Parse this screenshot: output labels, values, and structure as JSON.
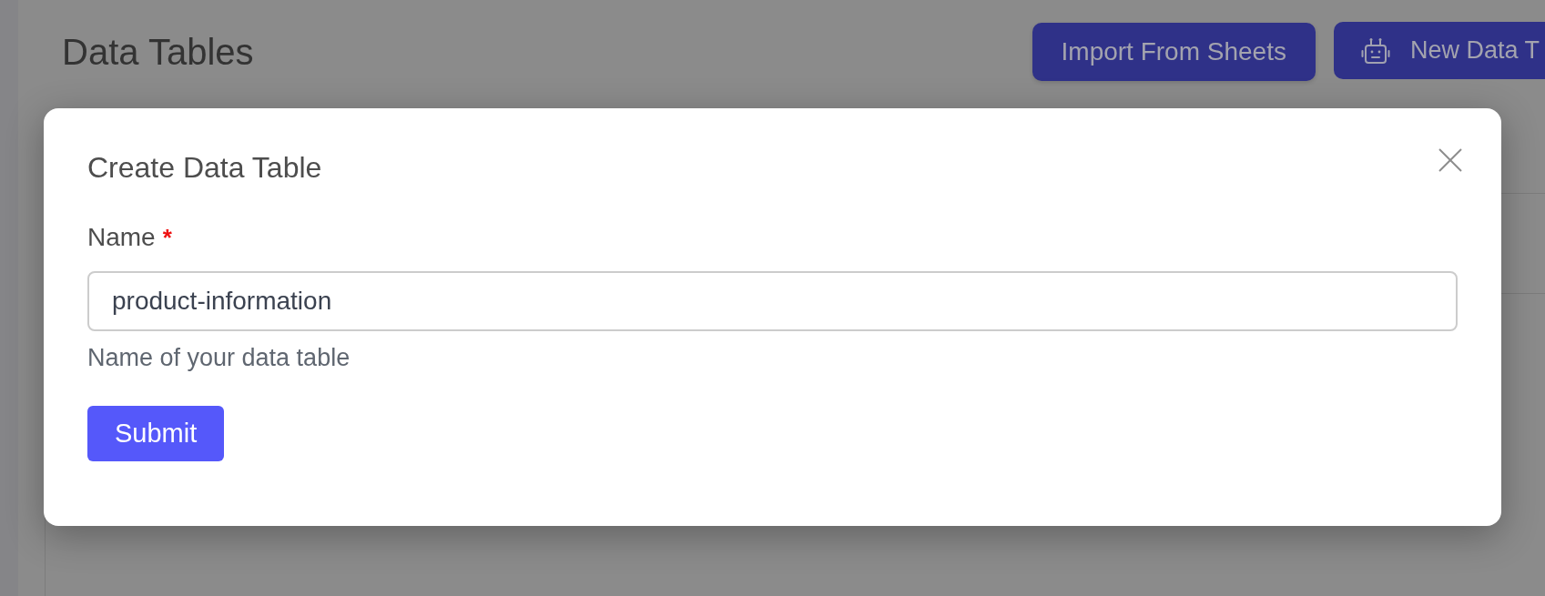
{
  "page": {
    "title": "Data Tables",
    "actions": [
      {
        "kind": "plain",
        "label": "Import From Sheets"
      },
      {
        "kind": "robot",
        "label": "New Data T"
      }
    ]
  },
  "dialog": {
    "title": "Create Data Table",
    "fields": [
      {
        "label": "Name",
        "required_mark": "*",
        "value": "product-information",
        "hint": "Name of your data table"
      }
    ],
    "submit": "Submit"
  }
}
